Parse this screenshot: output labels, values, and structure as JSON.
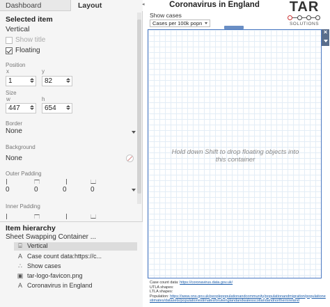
{
  "tabs": [
    "Dashboard",
    "Layout"
  ],
  "selected": {
    "heading": "Selected item",
    "name": "Vertical",
    "show_title": "Show title",
    "floating": "Floating"
  },
  "position": {
    "label": "Position",
    "x_label": "x",
    "y_label": "y",
    "x": "1",
    "y": "82"
  },
  "size": {
    "label": "Size",
    "w_label": "w",
    "h_label": "h",
    "w": "447",
    "h": "654"
  },
  "border": {
    "label": "Border",
    "value": "None"
  },
  "background": {
    "label": "Background",
    "value": "None"
  },
  "outer_padding": {
    "label": "Outer Padding",
    "values": [
      "0",
      "0",
      "0",
      "0"
    ]
  },
  "inner_padding": {
    "label": "Inner Padding"
  },
  "hierarchy": {
    "heading": "Item hierarchy",
    "root": "Sheet Swapping Container ...",
    "items": [
      {
        "icon": "layout-vertical-icon",
        "glyph": "⌸",
        "label": "Vertical"
      },
      {
        "icon": "text-icon",
        "glyph": "A",
        "label": "Case count data:https://c..."
      },
      {
        "icon": "parameter-icon",
        "glyph": "∴",
        "label": "Show cases"
      },
      {
        "icon": "image-icon",
        "glyph": "▣",
        "label": "tar-logo-favicon.png"
      },
      {
        "icon": "text-icon",
        "glyph": "A",
        "label": "Coronavirus in England"
      }
    ]
  },
  "dashboard": {
    "title": "Coronavirus in England",
    "show_cases_label": "Show cases",
    "show_cases_value": "Cases per 100k popn",
    "drop_hint": "Hold down Shift to drop floating objects into this container",
    "logo_text": "TAR",
    "logo_sub": "SOLUTIONS",
    "close_glyph": "×"
  },
  "footer": {
    "case_prefix": "Case count data: ",
    "case_link": "https://coronavirus.data.gov.uk/",
    "utla": "UTLA shapes:",
    "ltla": "LTLA shapes:",
    "pop_prefix": "Population: ",
    "pop_link": "https://www.ons.gov.uk/peoplepopulationandcommunity/populationandmigration/populationestimates/datasets/populationestimatesforukenglandandwalesscotlandandnorthernireland"
  },
  "colors": {
    "accent": "#4a78c2",
    "grid": "#e3edf6",
    "panel": "#f5f5f5"
  }
}
